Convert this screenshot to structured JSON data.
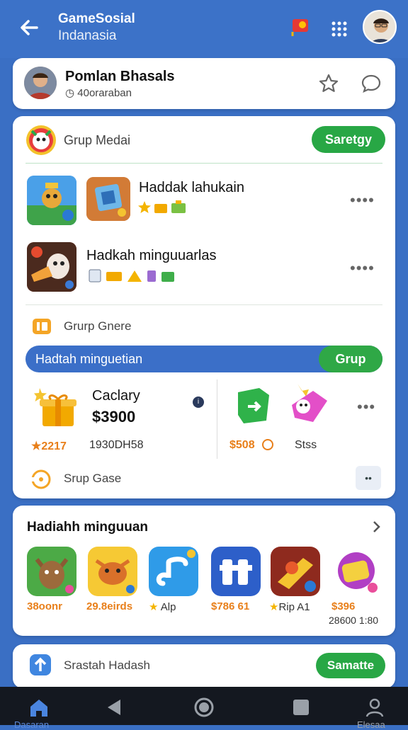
{
  "header": {
    "title": "GameSosial",
    "subtitle": "Indanasia"
  },
  "profile": {
    "name": "Pomlan Bhasals",
    "sub": "40oraraban"
  },
  "group": {
    "title": "Grup Medai",
    "action_label": "Saretgy",
    "rows": [
      {
        "label": "Haddak lahukain"
      },
      {
        "label": "Hadkah minguuarlas"
      }
    ],
    "section_title": "Grurp Gnere",
    "banner_label": "Hadtah minguetian",
    "banner_button": "Grup",
    "promo": {
      "title": "Caclary",
      "price": "$3900",
      "points": "2217",
      "code": "1930DH58",
      "right_price": "$508",
      "right_label": "Stss"
    },
    "footer_title": "Srup Gase"
  },
  "weekly": {
    "title": "Hadiahh minguuan",
    "apps": [
      {
        "name": "38oonr",
        "color": "#e87f1a"
      },
      {
        "name": "29.8eirds",
        "color": "#e87f1a"
      },
      {
        "name": "Alp",
        "color": "#333333"
      },
      {
        "name": "$786 61",
        "color": "#e87f1a"
      },
      {
        "name": "Rip A1",
        "color": "#333333"
      },
      {
        "name": "$396",
        "sub": "28600 1:80",
        "color": "#e87f1a"
      }
    ]
  },
  "last_card": {
    "title": "Srastah Hadash",
    "button": "Samatte"
  },
  "navbar": {
    "left_label": "Dasaran",
    "right_label": "Elesaa"
  }
}
